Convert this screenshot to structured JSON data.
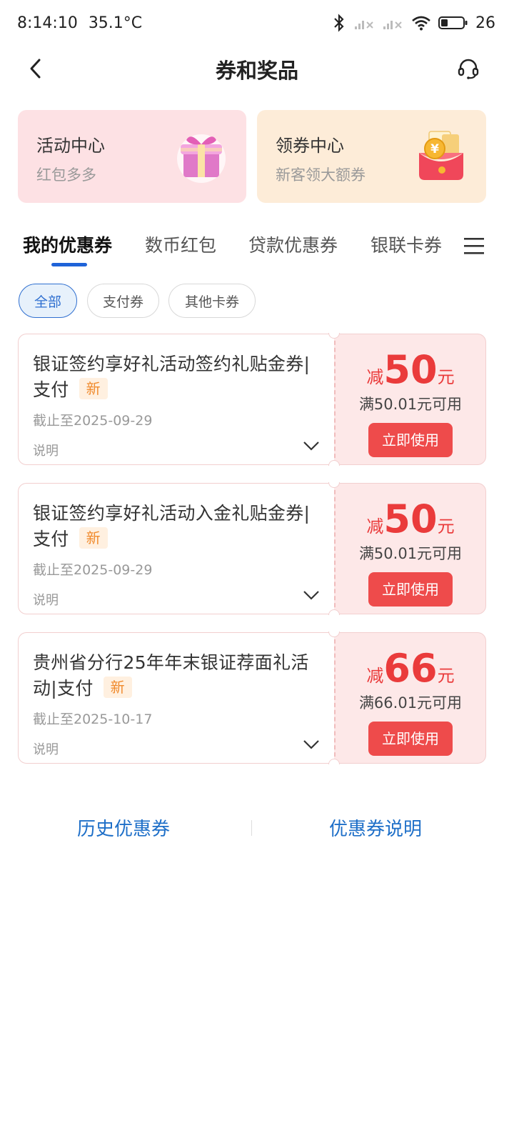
{
  "status_bar": {
    "time": "8:14:10",
    "temperature": "35.1°C",
    "battery": "26"
  },
  "header": {
    "title": "券和奖品",
    "back_icon": "chevron-left-icon",
    "service_icon": "headset-icon"
  },
  "promo_cards": [
    {
      "title": "活动中心",
      "subtitle": "红包多多",
      "icon": "gift-box-icon"
    },
    {
      "title": "领券中心",
      "subtitle": "新客领大额券",
      "icon": "red-envelope-coin-icon"
    }
  ],
  "tabs": [
    {
      "label": "我的优惠券",
      "active": true
    },
    {
      "label": "数币红包",
      "active": false
    },
    {
      "label": "贷款优惠券",
      "active": false
    },
    {
      "label": "银联卡券",
      "active": false
    }
  ],
  "filters": [
    {
      "label": "全部",
      "active": true
    },
    {
      "label": "支付券",
      "active": false
    },
    {
      "label": "其他卡券",
      "active": false
    }
  ],
  "coupons": [
    {
      "title": "银证签约享好礼活动签约礼贴金券|支付",
      "badge": "新",
      "date": "截止至2025-09-29",
      "note": "说明",
      "prefix": "减",
      "amount": "50",
      "unit": "元",
      "condition": "满50.01元可用",
      "button": "立即使用"
    },
    {
      "title": "银证签约享好礼活动入金礼贴金券|支付",
      "badge": "新",
      "date": "截止至2025-09-29",
      "note": "说明",
      "prefix": "减",
      "amount": "50",
      "unit": "元",
      "condition": "满50.01元可用",
      "button": "立即使用"
    },
    {
      "title": "贵州省分行25年年末银证荐面礼活动|支付",
      "badge": "新",
      "date": "截止至2025-10-17",
      "note": "说明",
      "prefix": "减",
      "amount": "66",
      "unit": "元",
      "condition": "满66.01元可用",
      "button": "立即使用"
    }
  ],
  "footer": {
    "history_link": "历史优惠券",
    "rules_link": "优惠券说明"
  },
  "colors": {
    "accent_blue": "#1f63d8",
    "coupon_red": "#ea3b3b",
    "button_red": "#ee4b4b",
    "badge_orange": "#f08a2c",
    "link_blue": "#1e6fc8"
  }
}
